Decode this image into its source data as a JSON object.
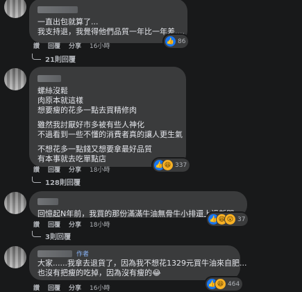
{
  "comments": [
    {
      "lines": [
        "一直出包就算了...",
        "我支持退，我覺得他們品質一年比一年差...."
      ],
      "actions": {
        "like": "讚",
        "reply": "回覆",
        "share": "分享",
        "time": "16小時"
      },
      "reactions": {
        "count": "86"
      },
      "replies": "21則回覆"
    },
    {
      "lines": [
        "螺絲沒鬆",
        "肉原本就這樣",
        "想要瘦的花多一點去買精修肉",
        "",
        "雖然我討厭好市多被有些人神化",
        "不過看到一些不懂的消費者真的讓人更生氣",
        "",
        "不想花多一點錢又想要拿最好品質",
        "有本事就去吃單點店"
      ],
      "actions": {
        "like": "讚",
        "reply": "回覆",
        "share": "分享",
        "time": "18小時"
      },
      "reactions": {
        "count": "337"
      },
      "replies": "128則回覆"
    },
    {
      "lines": [
        "回憶起N年前，我買的那份滿滿牛油無骨牛小排還上過新聞...."
      ],
      "actions": {
        "like": "讚",
        "reply": "回覆",
        "share": "分享",
        "time": "18小時"
      },
      "reactions": {
        "count": "37"
      },
      "replies": "3則回覆"
    },
    {
      "author_tag": "作者",
      "lines": [
        "大家......我拿去退貨了，因為我不想花1329元買牛油來自肥...",
        "也沒有把瘦的吃掉，因為沒有瘦的😂"
      ],
      "actions": {
        "like": "讚",
        "reply": "回覆",
        "share": "分享",
        "time": "16小時"
      },
      "reactions": {
        "count": "464"
      }
    }
  ]
}
